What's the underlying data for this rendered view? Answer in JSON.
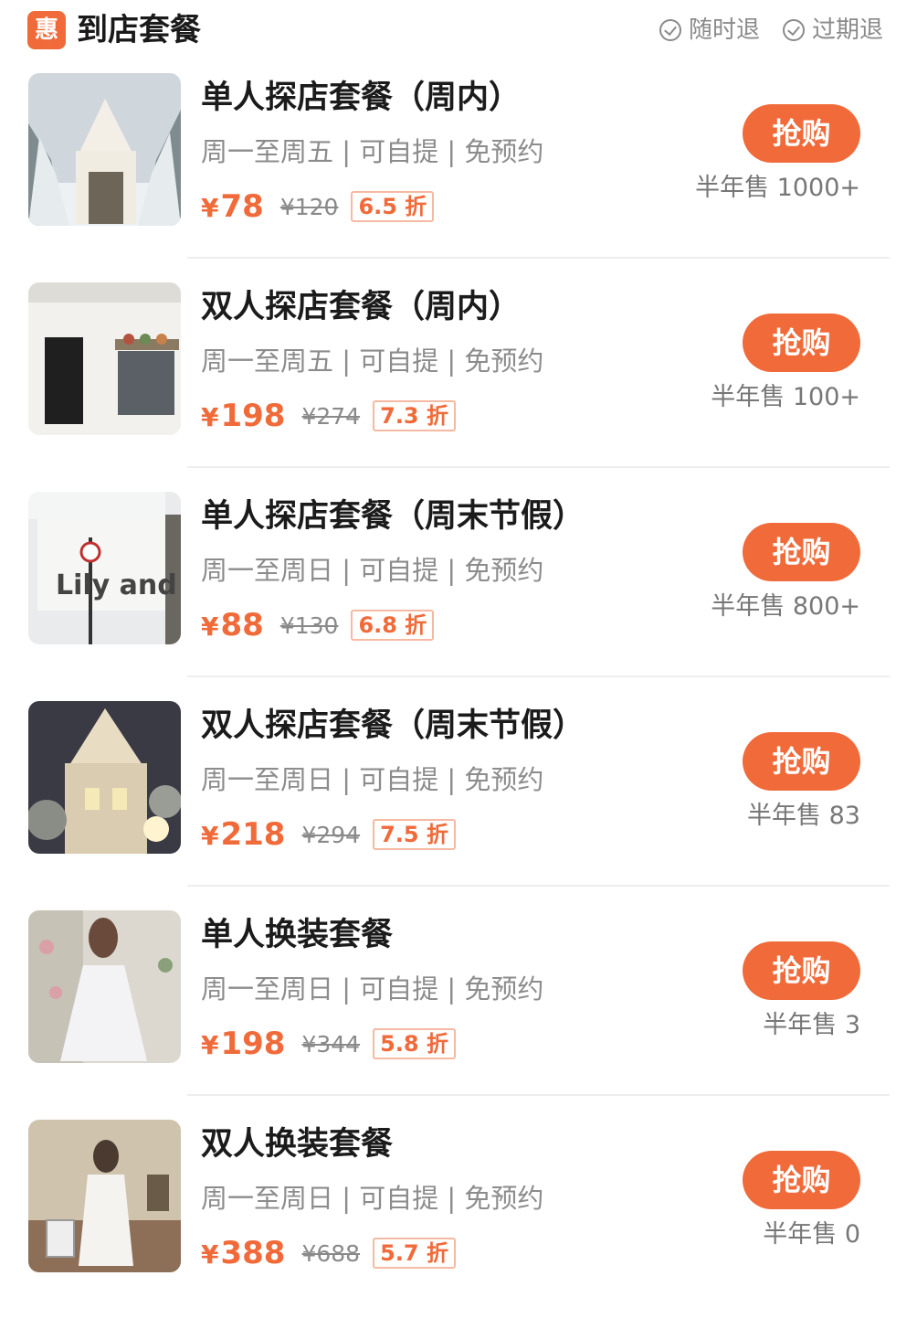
{
  "header": {
    "badge": "惠",
    "title": "到店套餐",
    "policies": [
      "随时退",
      "过期退"
    ]
  },
  "items": [
    {
      "title": "单人探店套餐（周内）",
      "sub": "周一至周五 | 可自提 | 免预约",
      "currency": "¥",
      "price": "78",
      "orig": "¥120",
      "discount": "6.5 折",
      "buy": "抢购",
      "sales": "半年售 1000+"
    },
    {
      "title": "双人探店套餐（周内）",
      "sub": "周一至周五 | 可自提 | 免预约",
      "currency": "¥",
      "price": "198",
      "orig": "¥274",
      "discount": "7.3 折",
      "buy": "抢购",
      "sales": "半年售 100+"
    },
    {
      "title": "单人探店套餐（周末节假）",
      "sub": "周一至周日 | 可自提 | 免预约",
      "currency": "¥",
      "price": "88",
      "orig": "¥130",
      "discount": "6.8 折",
      "buy": "抢购",
      "sales": "半年售 800+"
    },
    {
      "title": "双人探店套餐（周末节假）",
      "sub": "周一至周日 | 可自提 | 免预约",
      "currency": "¥",
      "price": "218",
      "orig": "¥294",
      "discount": "7.5 折",
      "buy": "抢购",
      "sales": "半年售 83"
    },
    {
      "title": "单人换装套餐",
      "sub": "周一至周日 | 可自提 | 免预约",
      "currency": "¥",
      "price": "198",
      "orig": "¥344",
      "discount": "5.8 折",
      "buy": "抢购",
      "sales": "半年售 3"
    },
    {
      "title": "双人换装套餐",
      "sub": "周一至周日 | 可自提 | 免预约",
      "currency": "¥",
      "price": "388",
      "orig": "¥688",
      "discount": "5.7 折",
      "buy": "抢购",
      "sales": "半年售 0"
    }
  ],
  "colors": {
    "accent": "#f06a3a",
    "muted": "#8a8a8a",
    "title": "#1b1b1b"
  }
}
